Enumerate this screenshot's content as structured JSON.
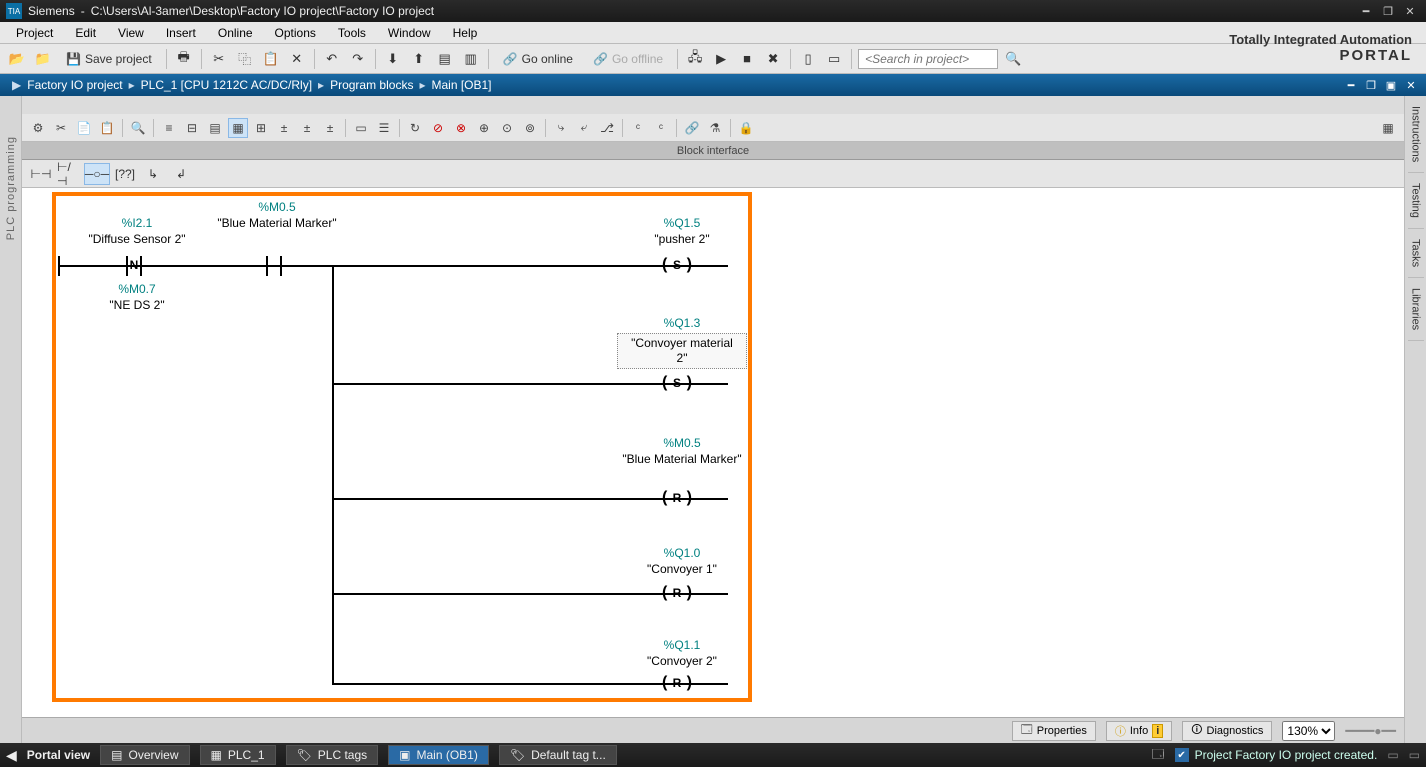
{
  "titlebar": {
    "app": "Siemens",
    "path": "C:\\Users\\Al-3amer\\Desktop\\Factory IO project\\Factory IO project"
  },
  "menu": [
    "Project",
    "Edit",
    "View",
    "Insert",
    "Online",
    "Options",
    "Tools",
    "Window",
    "Help"
  ],
  "brand": {
    "line1": "Totally Integrated Automation",
    "line2": "PORTAL"
  },
  "toolbar": {
    "save_label": "Save project",
    "goonline": "Go online",
    "gooffline": "Go offline",
    "search_placeholder": "<Search in project>"
  },
  "breadcrumb": [
    "Factory IO project",
    "PLC_1 [CPU 1212C AC/DC/Rly]",
    "Program blocks",
    "Main [OB1]"
  ],
  "leftstrip": "PLC programming",
  "righttabs": [
    "Instructions",
    "Testing",
    "Tasks",
    "Libraries"
  ],
  "blockiface": "Block interface",
  "zoom": "130%",
  "panels": {
    "properties": "Properties",
    "info": "Info",
    "diag": "Diagnostics"
  },
  "ladder": {
    "i1": {
      "addr": "%I2.1",
      "name": "\"Diffuse Sensor 2\""
    },
    "m05": {
      "addr": "%M0.5",
      "name": "\"Blue Material Marker\""
    },
    "m07": {
      "addr": "%M0.7",
      "name": "\"NE DS 2\""
    },
    "q15": {
      "addr": "%Q1.5",
      "name": "\"pusher 2\""
    },
    "q13": {
      "addr": "%Q1.3",
      "name": "\"Convoyer material 2\""
    },
    "m05b": {
      "addr": "%M0.5",
      "name": "\"Blue Material Marker\""
    },
    "q10": {
      "addr": "%Q1.0",
      "name": "\"Convoyer 1\""
    },
    "q11": {
      "addr": "%Q1.1",
      "name": "\"Convoyer 2\""
    }
  },
  "taskbar": {
    "portal": "Portal view",
    "tabs": [
      "Overview",
      "PLC_1",
      "PLC tags",
      "Main (OB1)",
      "Default tag t..."
    ],
    "status": "Project Factory IO project created."
  }
}
